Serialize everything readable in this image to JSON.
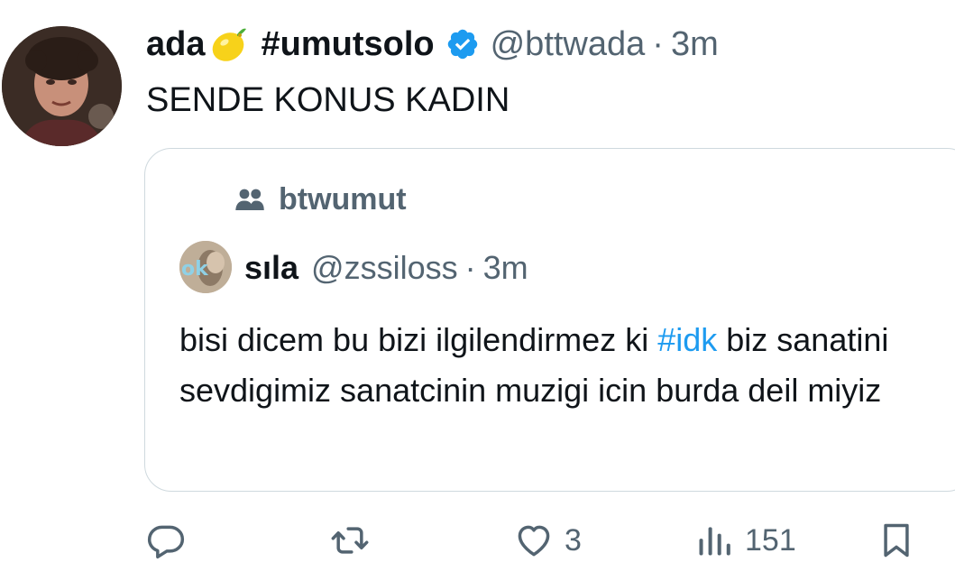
{
  "tweet": {
    "display_name": "ada",
    "display_name_emoji": "lemon-icon",
    "hashtag_name": "#umutsolo",
    "handle": "@bttwada",
    "separator": "·",
    "time": "3m",
    "text": "SENDE KONUS KADIN",
    "verified": true
  },
  "quote": {
    "community": "btwumut",
    "name": "sıla",
    "handle": "@zssiloss",
    "separator": "·",
    "time": "3m",
    "text_before": "bisi dicem bu bizi ilgilendirmez ki ",
    "hashtag": "#idk",
    "text_after": " biz sanatini sevdigimiz sanatcinin muzigi icin burda deil miyiz",
    "avatar_text": "ok"
  },
  "actions": {
    "reply_count": "",
    "retweet_count": "",
    "like_count": "3",
    "view_count": "151"
  },
  "colors": {
    "text": "#0f1419",
    "secondary": "#536471",
    "link": "#1d9bf0",
    "verified": "#1d9bf0",
    "border": "#cfd9de"
  }
}
